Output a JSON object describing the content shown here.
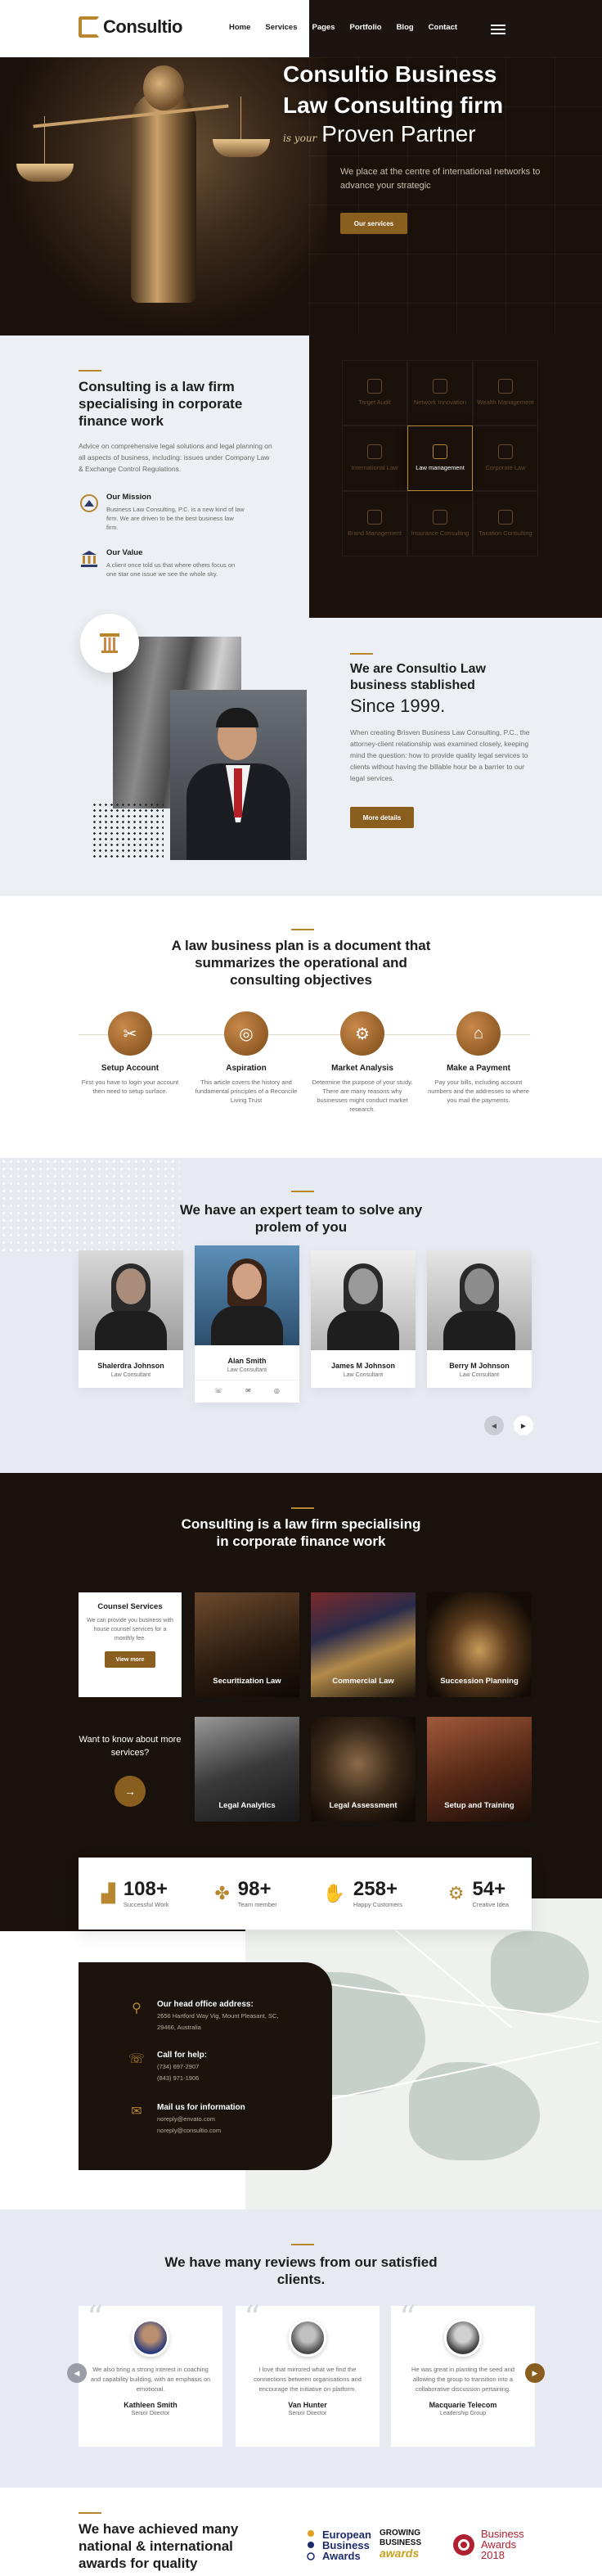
{
  "header": {
    "logo_text": "Consultio",
    "nav": [
      "Home",
      "Services",
      "Pages",
      "Portfolio",
      "Blog",
      "Contact"
    ]
  },
  "hero": {
    "title": "Consultio Business Law Consulting firm",
    "tag_script": "is your",
    "tag_big": "Proven Partner",
    "subtitle": "We place at the centre of international networks to advance your strategic",
    "button": "Our services"
  },
  "about": {
    "title": "Consulting is a law firm specialising in corporate finance work",
    "text": "Advice on comprehensive legal solutions and legal planning on all aspects of business, including: issues under Company Law & Exchange Control Regulations.",
    "features": [
      {
        "title": "Our Mission",
        "text": "Business Law Consulting, P.C. is a new kind of law firm. We are driven to be the best business law firm."
      },
      {
        "title": "Our Value",
        "text": "A client once told us that where others focus on one star one issue we see the whole sky."
      }
    ],
    "services": [
      "Target Audit",
      "Network Innovation",
      "Wealth Management",
      "International Law",
      "Law management",
      "Corporate Law",
      "Brand Management",
      "Insurance Consulting",
      "Taxation Consulting"
    ]
  },
  "established": {
    "title": "We are Consultio Law business stablished",
    "year": "Since 1999.",
    "text": "When creating Brisven Business Law Consulting, P.C., the attorney-client relationship was examined closely, keeping mind the question: how to provide quality legal services to clients without having the billable hour be a barrier to our legal services.",
    "button": "More details"
  },
  "plan": {
    "title": "A law business plan is a document that summarizes the operational and consulting objectives",
    "steps": [
      {
        "title": "Setup Account",
        "text": "First you have to login your account then need to setup surface."
      },
      {
        "title": "Aspiration",
        "text": "This article covers the history and fundamental principles of a Reconcile Living Trust"
      },
      {
        "title": "Market Analysis",
        "text": "Determine the purpose of your study. There are many reasons why businesses might conduct market research."
      },
      {
        "title": "Make a Payment",
        "text": "Pay your bills, including account numbers and the addresses to where you mail the payments."
      }
    ]
  },
  "team": {
    "title": "We have an expert team to solve any prolem of you",
    "members": [
      {
        "name": "Shalerdra Johnson",
        "role": "Law Consultant"
      },
      {
        "name": "Alan Smith",
        "role": "Law Consultant"
      },
      {
        "name": "James M Johnson",
        "role": "Law Consultant"
      },
      {
        "name": "Berry M Johnson",
        "role": "Law Consultant"
      }
    ],
    "social": [
      "☏",
      "✉",
      "◎"
    ]
  },
  "services_dark": {
    "title": "Consulting is a law firm specialising in corporate finance work",
    "counsel_title": "Counsel Services",
    "counsel_text": "We can provide you business with house counsel services for a monthly fee.",
    "counsel_button": "View more",
    "tiles": [
      "Securitization Law",
      "Commercial Law",
      "Succession Planning",
      "Legal Analytics",
      "Legal Assessment",
      "Setup and Training"
    ],
    "more_question": "Want to know about more services?",
    "more_arrow": "→"
  },
  "stats": [
    {
      "number": "108+",
      "label": "Successful Work",
      "icon": "▟"
    },
    {
      "number": "98+",
      "label": "Team member",
      "icon": "✤"
    },
    {
      "number": "258+",
      "label": "Happy Customers",
      "icon": "✋"
    },
    {
      "number": "54+",
      "label": "Creative Idea",
      "icon": "⚙"
    }
  ],
  "contact": {
    "office_title": "Our head office address:",
    "office_lines": [
      "2656 Hartford Way Vig, Mount Pleasant, SC,",
      "29466, Australia"
    ],
    "call_title": "Call for help:",
    "call_lines": [
      "(734) 697-2907",
      "(843) 971-1906"
    ],
    "mail_title": "Mail us for information",
    "mail_lines": [
      "noreply@envato.com",
      "noreply@consultio.com"
    ]
  },
  "reviews": {
    "title": "We have many reviews from our satisfied clients.",
    "items": [
      {
        "text": "We also bring a strong interest in coaching and capability building, with an emphasis on emotional.",
        "name": "Kathleen Smith",
        "role": "Senior Director"
      },
      {
        "text": "I love that mirrored what we find the connections between organisations and encourage the initiative on platform.",
        "name": "Van Hunter",
        "role": "Senior Director"
      },
      {
        "text": "He was great in planting the seed and allowing the group to transition into a collaborative discussion pertaining.",
        "name": "Macquarie Telecom",
        "role": "Leadership Group"
      }
    ]
  },
  "awards": {
    "title": "We have achieved many national & international awards for quality",
    "logos": [
      {
        "lines": [
          "European",
          "Business",
          "Awards"
        ]
      },
      {
        "lines": [
          "GROWING",
          "BUSINESS",
          "awards"
        ]
      },
      {
        "lines": [
          "Business",
          "Awards",
          "2018"
        ]
      }
    ]
  },
  "colors": {
    "accent": "#b7862f",
    "dark": "#1a110b",
    "light_bg": "#eceff3"
  }
}
